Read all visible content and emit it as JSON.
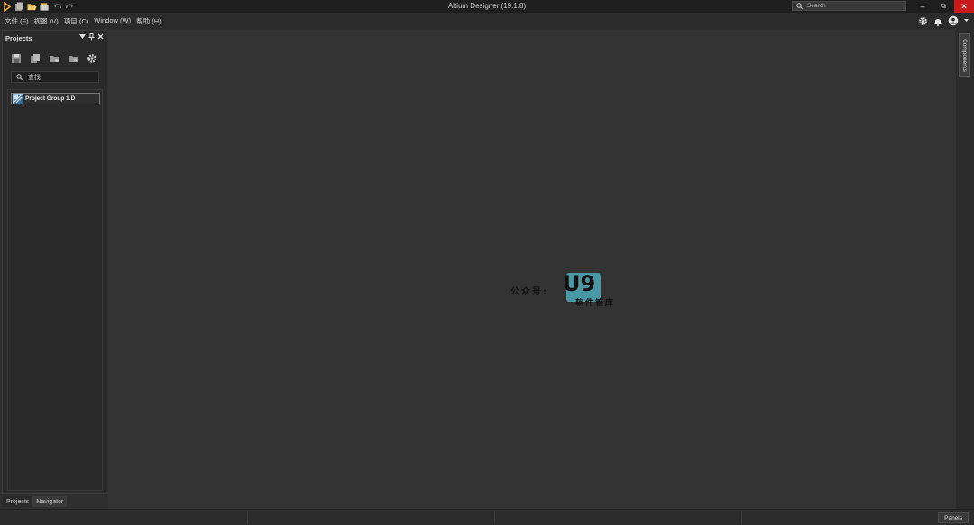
{
  "window": {
    "title": "Altium Designer (19.1.8)",
    "search_placeholder": "Search",
    "minimize": "–",
    "restore": "⧉",
    "close": "✕"
  },
  "menubar": {
    "items": [
      "文件 (F)",
      "视图 (V)",
      "项目 (C)",
      "Window (W)",
      "帮助 (H)"
    ]
  },
  "projects_panel": {
    "title": "Projects",
    "find_placeholder": "查找",
    "tree_items": [
      "Project Group 1.D"
    ],
    "tabs": [
      "Projects",
      "Navigator"
    ]
  },
  "right_dock": {
    "components_tab": "Components"
  },
  "watermark": {
    "prefix": "公众号:",
    "logo": "U9",
    "subtitle": "软件管库"
  },
  "statusbar": {
    "panels_button": "Panels"
  },
  "colors": {
    "accent_icon": "#e8a93a",
    "close_button": "#c81a1a",
    "workspace": "#333333",
    "watermark_logo": "#4a97a6"
  }
}
